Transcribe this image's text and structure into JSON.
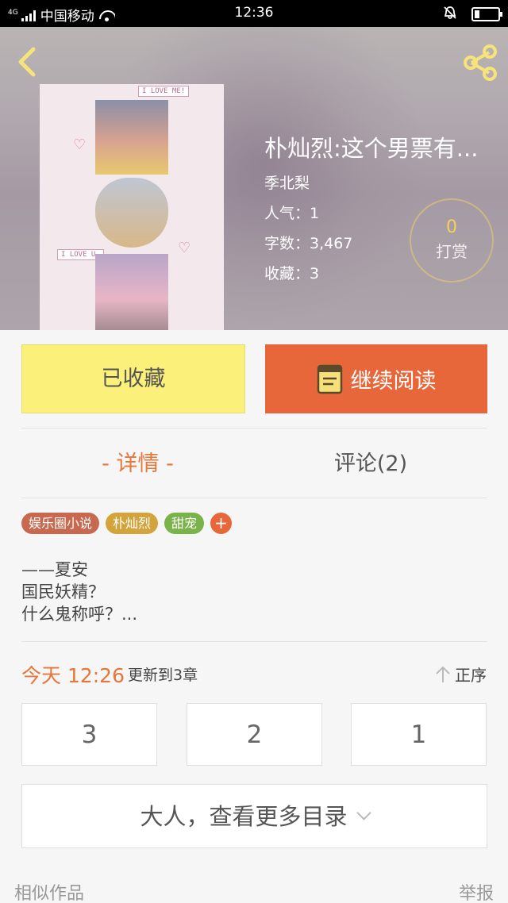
{
  "status_bar": {
    "network": "4G",
    "carrier": "中国移动",
    "time": "12:36",
    "battery_level_fraction": 0.2
  },
  "header": {
    "back_icon": "chevron-left-icon",
    "share_icon": "share-icon",
    "cover_texts": [
      "I LOVE ME!",
      "I LOVE U."
    ],
    "title": "朴灿烈:这个男票有...",
    "author": "季北梨",
    "popularity": "人气：1",
    "word_count": "字数：3,467",
    "favorites": "收藏：3",
    "reward": {
      "count": "0",
      "label": "打赏"
    }
  },
  "actions": {
    "collected_label": "已收藏",
    "continue_label": "继续阅读"
  },
  "tabs": [
    {
      "label": "- 详情 -",
      "active": true
    },
    {
      "label": "评论(2)",
      "active": false
    }
  ],
  "tags": [
    {
      "label": "娱乐圈小说",
      "color": "#c8694f"
    },
    {
      "label": "朴灿烈",
      "color": "#d3a43c"
    },
    {
      "label": "甜宠",
      "color": "#7ab34a"
    },
    {
      "label": "+",
      "color": "#e8673a"
    }
  ],
  "intro_lines": [
    "——夏安",
    "国民妖精？",
    "什么鬼称呼？..."
  ],
  "update": {
    "time": "今天 12:26",
    "text": "更新到3章",
    "order_label": "正序"
  },
  "chapters": [
    "3",
    "2",
    "1"
  ],
  "more_catalog_label": "大人，查看更多目录",
  "footer": {
    "similar_label": "相似作品",
    "report_label": "举报"
  },
  "colors": {
    "accent_orange": "#e8673a",
    "collected_yellow": "#fbf07a",
    "tab_active": "#e8763a"
  }
}
